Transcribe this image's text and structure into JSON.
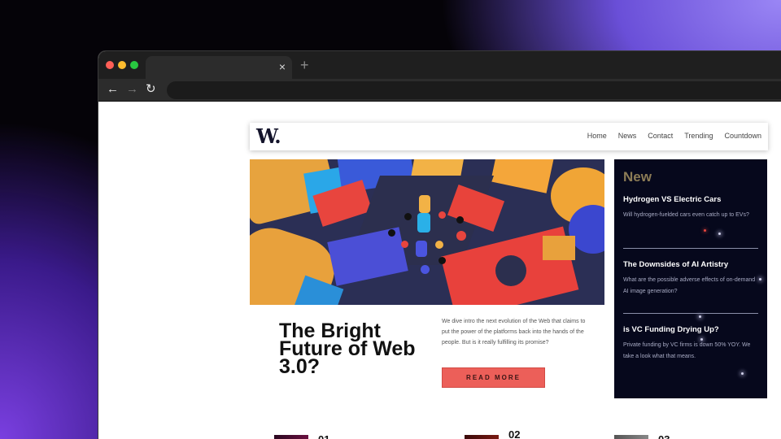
{
  "browser": {
    "tab_close_icon": "×",
    "new_tab_icon": "+",
    "back_icon": "←",
    "forward_icon": "→",
    "reload_icon": "↻"
  },
  "site": {
    "logo": "W.",
    "nav": [
      "Home",
      "News",
      "Contact",
      "Trending",
      "Countdown"
    ]
  },
  "article": {
    "title": "The Bright Future of Web 3.0?",
    "description": "We dive intro the next evolution of the Web that claims to put the power of the platforms back into the hands of the people. But is it really fulfilling its promise?",
    "cta": "READ MORE"
  },
  "news": {
    "heading": "New",
    "items": [
      {
        "title": "Hydrogen VS Electric Cars",
        "desc": "Will hydrogen-fuelded cars even catch up to EVs?"
      },
      {
        "title": "The Downsides of AI Artistry",
        "desc": "What are the possible adverse effects of on-demand AI image generation?"
      },
      {
        "title": "is VC Funding Drying Up?",
        "desc": "Private funding by VC firms is down 50% YOY. We take a look what that means."
      }
    ]
  },
  "bottom": {
    "numbers": [
      "01",
      "02",
      "03"
    ]
  },
  "colors": {
    "accent": "#ec5f59",
    "news_bg": "#06081c",
    "news_heading": "#8c7c56"
  }
}
